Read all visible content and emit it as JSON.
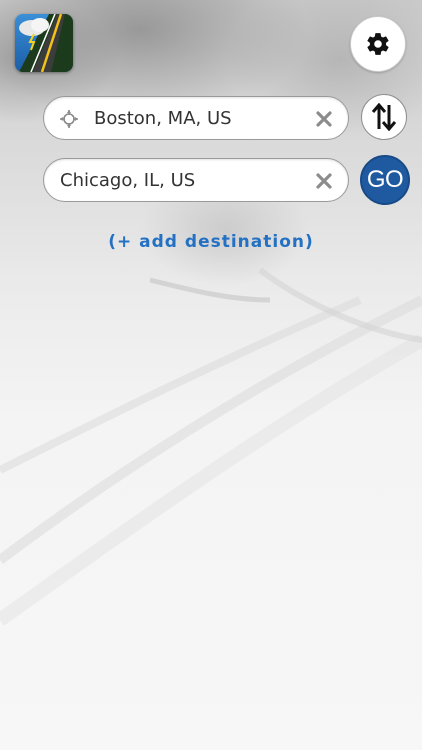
{
  "app": {
    "icon_name": "weather-road-app-icon"
  },
  "toolbar": {
    "settings_icon": "gear-icon"
  },
  "route": {
    "origin": {
      "value": "Boston, MA, US",
      "locate_icon": "crosshair-icon",
      "clear_icon": "close-icon"
    },
    "destination": {
      "value": "Chicago, IL, US",
      "clear_icon": "close-icon"
    },
    "swap_icon": "swap-vertical-icon",
    "go_label": "GO",
    "add_destination_label": "(+ add destination)"
  },
  "colors": {
    "go_button": "#1f5aa0",
    "link": "#2471c4",
    "field_border": "#9a9a9a"
  }
}
